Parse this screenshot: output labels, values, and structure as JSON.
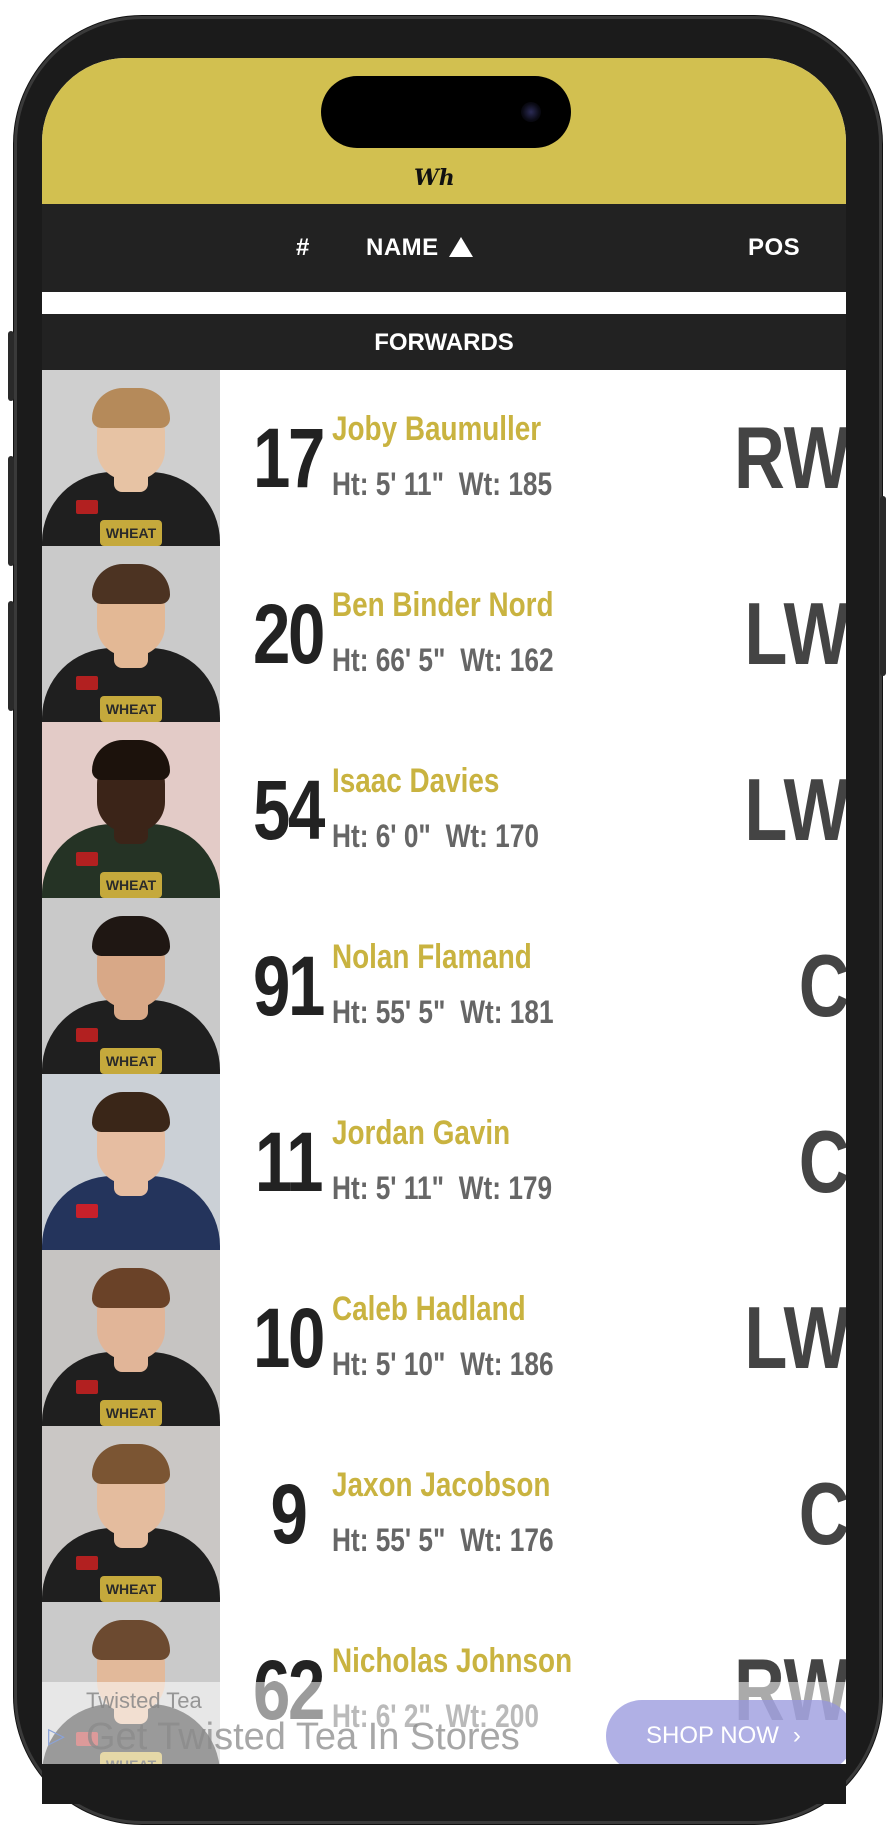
{
  "header": {
    "logo_text": "Wh"
  },
  "sort_bar": {
    "col_number": "#",
    "col_name": "NAME",
    "col_pos": "POS"
  },
  "section": {
    "title": "FORWARDS"
  },
  "players": [
    {
      "number": "17",
      "name": "Joby Baumuller",
      "height": "Ht: 5' 11\"",
      "weight": "Wt: 185",
      "pos": "RW",
      "bg": "#cfcfcf",
      "jersey": "#1f1f1f",
      "skin": "#e7c3a4",
      "hair": "#b58a5a",
      "crest": "WHEAT"
    },
    {
      "number": "20",
      "name": "Ben Binder Nord",
      "height": "Ht: 66' 5\"",
      "weight": "Wt: 162",
      "pos": "LW",
      "bg": "#cacaca",
      "jersey": "#1f1f1f",
      "skin": "#e3b895",
      "hair": "#4c3322",
      "crest": "WHEAT"
    },
    {
      "number": "54",
      "name": "Isaac Davies",
      "height": "Ht: 6' 0\"",
      "weight": "Wt: 170",
      "pos": "LW",
      "bg": "#e3cbc7",
      "jersey": "#253325",
      "skin": "#3b2418",
      "hair": "#1c120c",
      "crest": "WHEAT"
    },
    {
      "number": "91",
      "name": "Nolan Flamand",
      "height": "Ht: 55' 5\"",
      "weight": "Wt: 181",
      "pos": "C",
      "bg": "#c9c9c9",
      "jersey": "#1f1f1f",
      "skin": "#d8a887",
      "hair": "#1f1713",
      "crest": "WHEAT"
    },
    {
      "number": "11",
      "name": "Jordan Gavin",
      "height": "Ht: 5' 11\"",
      "weight": "Wt: 179",
      "pos": "C",
      "bg": "#cbd0d6",
      "jersey": "#24345c",
      "skin": "#e6bda1",
      "hair": "#3a2618",
      "crest": ""
    },
    {
      "number": "10",
      "name": "Caleb Hadland",
      "height": "Ht: 5' 10\"",
      "weight": "Wt: 186",
      "pos": "LW",
      "bg": "#c6c4c2",
      "jersey": "#1f1f1f",
      "skin": "#e1b598",
      "hair": "#6a4228",
      "crest": "WHEAT"
    },
    {
      "number": "9",
      "name": "Jaxon Jacobson",
      "height": "Ht: 55' 5\"",
      "weight": "Wt: 176",
      "pos": "C",
      "bg": "#cac7c5",
      "jersey": "#1f1f1f",
      "skin": "#e4bc9e",
      "hair": "#7b5533",
      "crest": "WHEAT"
    },
    {
      "number": "62",
      "name": "Nicholas Johnson",
      "height": "Ht: 6' 2\"",
      "weight": "Wt: 200",
      "pos": "RW",
      "bg": "#cacaca",
      "jersey": "#1f1f1f",
      "skin": "#e2b99a",
      "hair": "#6c4a30",
      "crest": "WHEAT"
    }
  ],
  "ad": {
    "sponsor": "Twisted Tea",
    "headline": "Get Twisted Tea In Stores",
    "cta": "SHOP NOW"
  }
}
